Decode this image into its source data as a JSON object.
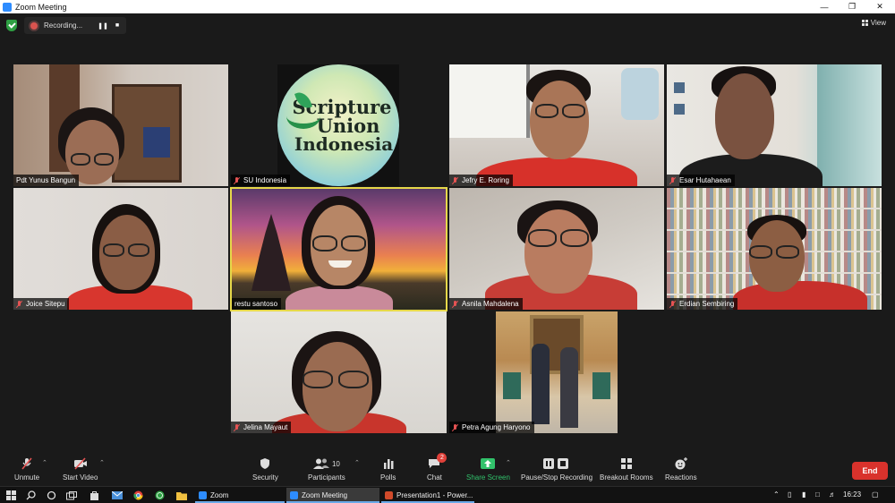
{
  "window": {
    "title": "Zoom Meeting"
  },
  "recording": {
    "status": "Recording...",
    "pause_icon": "pause-icon",
    "stop_icon": "stop-icon"
  },
  "view": {
    "label": "View"
  },
  "logo": {
    "line1": "Scripture",
    "line2": "Union",
    "line3": "Indonesia"
  },
  "participants": [
    {
      "name": "Pdt Yunus Bangun",
      "muted": false
    },
    {
      "name": "SU Indonesia",
      "muted": true
    },
    {
      "name": "Jefry E. Roring",
      "muted": true
    },
    {
      "name": "Esar Hutahaean",
      "muted": true
    },
    {
      "name": "Joice Sitepu",
      "muted": true
    },
    {
      "name": "restu santoso",
      "muted": false,
      "active_speaker": true
    },
    {
      "name": "Asnila Mahdalena",
      "muted": true
    },
    {
      "name": "Erdian Sembiring",
      "muted": true
    },
    {
      "name": "Jelina Mayaut",
      "muted": true
    },
    {
      "name": "Petra Agung Haryono",
      "muted": true
    }
  ],
  "toolbar": {
    "unmute": "Unmute",
    "start_video": "Start Video",
    "security": "Security",
    "participants": "Participants",
    "participants_count": "10",
    "polls": "Polls",
    "chat": "Chat",
    "chat_badge": "2",
    "share_screen": "Share Screen",
    "recording": "Pause/Stop Recording",
    "breakout": "Breakout Rooms",
    "reactions": "Reactions",
    "end": "End"
  },
  "taskbar": {
    "apps": [
      "Zoom",
      "Zoom Meeting",
      "Presentation1 - Power..."
    ],
    "time": "16:23"
  },
  "colors": {
    "accent_green": "#31c26b",
    "end_red": "#d9322c",
    "active_border": "#e6d84a"
  }
}
